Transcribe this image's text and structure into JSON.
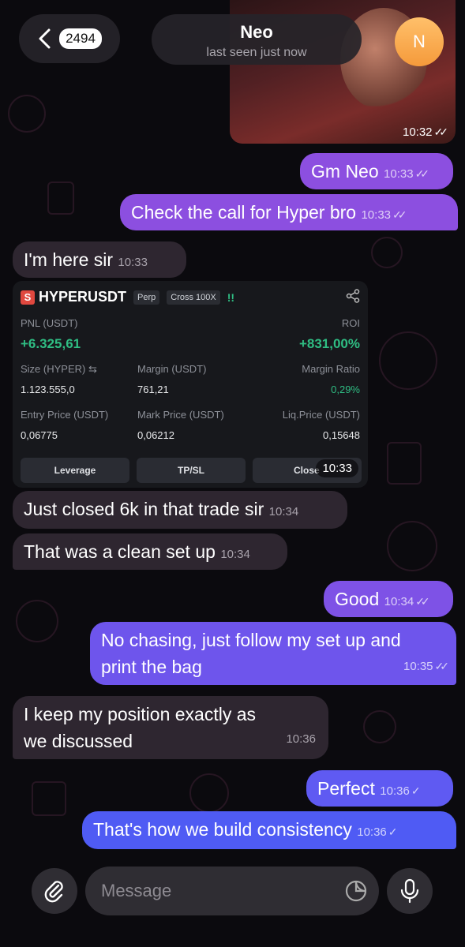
{
  "header": {
    "unread_count": "2494",
    "contact_name": "Neo",
    "status": "last seen just now",
    "avatar_letter": "N"
  },
  "image_message": {
    "time": "10:32"
  },
  "messages": [
    {
      "text": "Gm Neo",
      "time": "10:33",
      "direction": "out"
    },
    {
      "text": "Check the call for Hyper bro",
      "time": "10:33",
      "direction": "out"
    },
    {
      "text": "I'm here sir",
      "time": "10:33",
      "direction": "in"
    },
    {
      "text": "Just closed 6k in that trade sir",
      "time": "10:34",
      "direction": "in"
    },
    {
      "text": "That was a clean set up",
      "time": "10:34",
      "direction": "in"
    },
    {
      "text": "Good",
      "time": "10:34",
      "direction": "out"
    },
    {
      "text": "No chasing, just follow my set up and print the bag",
      "time": "10:35",
      "direction": "out"
    },
    {
      "text": "I keep my position exactly as we discussed",
      "time": "10:36",
      "direction": "in"
    },
    {
      "text": "Perfect",
      "time": "10:36",
      "direction": "out"
    },
    {
      "text": "That's how we build consistency",
      "time": "10:36",
      "direction": "out"
    }
  ],
  "trade_card": {
    "logo": "S",
    "symbol": "HYPERUSDT",
    "type": "Perp",
    "margin_mode": "Cross 100X",
    "alert": "!!",
    "pnl_label": "PNL (USDT)",
    "pnl_value": "+6.325,61",
    "roi_label": "ROI",
    "roi_value": "+831,00%",
    "size_label": "Size (HYPER) ⇆",
    "size_value": "1.123.555,0",
    "margin_label": "Margin (USDT)",
    "margin_value": "761,21",
    "margin_ratio_label": "Margin Ratio",
    "margin_ratio_value": "0,29%",
    "entry_label": "Entry Price (USDT)",
    "entry_value": "0,06775",
    "mark_label": "Mark Price (USDT)",
    "mark_value": "0,06212",
    "liq_label": "Liq.Price (USDT)",
    "liq_value": "0,15648",
    "buttons": [
      "Leverage",
      "TP/SL",
      "Close"
    ],
    "time": "10:33"
  },
  "composer": {
    "placeholder": "Message"
  },
  "colors": {
    "outgoing_purple": "#8c4fe0",
    "outgoing_blue": "#5a58f0",
    "incoming": "#2e2630",
    "profit_green": "#2fbd83"
  },
  "icons": [
    "chevron-left-icon",
    "paperclip-icon",
    "sticker-icon",
    "microphone-icon",
    "share-icon",
    "double-check-icon"
  ]
}
